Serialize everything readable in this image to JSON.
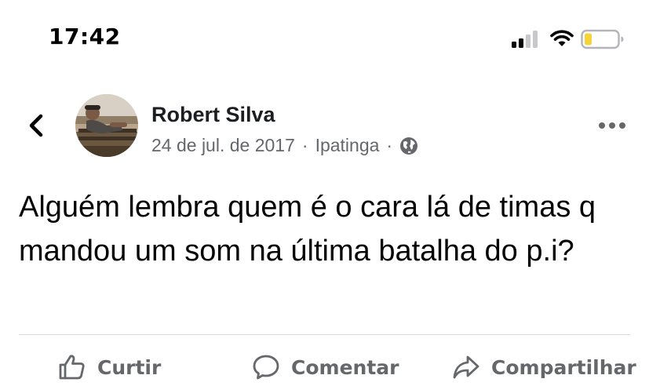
{
  "status_bar": {
    "time": "17:42",
    "signal_icon": "signal-icon",
    "wifi_icon": "wifi-icon",
    "battery_icon": "battery-icon",
    "battery_color": "#f6d33b"
  },
  "header": {
    "back_icon": "chevron-left-icon",
    "author_name": "Robert Silva",
    "date": "24 de jul. de 2017",
    "separator": "·",
    "location": "Ipatinga",
    "privacy_icon": "globe-icon",
    "more_icon": "more-options-icon"
  },
  "post": {
    "text": "Alguém lembra quem é o cara lá de timas q mandou um som na última batalha do p.i?"
  },
  "actions": {
    "like_label": "Curtir",
    "like_icon": "thumbs-up-icon",
    "comment_label": "Comentar",
    "comment_icon": "comment-icon",
    "share_label": "Compartilhar",
    "share_icon": "share-icon"
  },
  "colors": {
    "text": "#050505",
    "secondary": "#65676b",
    "divider": "#d9dadc"
  }
}
